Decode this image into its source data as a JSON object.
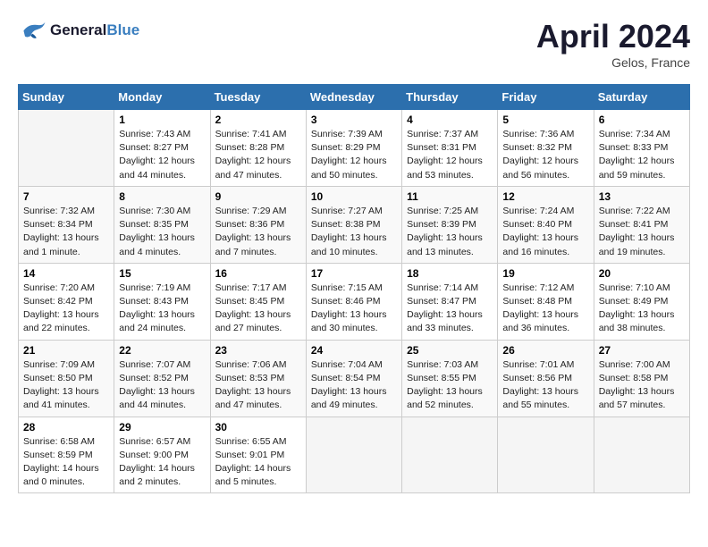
{
  "header": {
    "logo_line1": "General",
    "logo_line2": "Blue",
    "month": "April 2024",
    "location": "Gelos, France"
  },
  "columns": [
    "Sunday",
    "Monday",
    "Tuesday",
    "Wednesday",
    "Thursday",
    "Friday",
    "Saturday"
  ],
  "weeks": [
    [
      {
        "day": "",
        "info": ""
      },
      {
        "day": "1",
        "info": "Sunrise: 7:43 AM\nSunset: 8:27 PM\nDaylight: 12 hours\nand 44 minutes."
      },
      {
        "day": "2",
        "info": "Sunrise: 7:41 AM\nSunset: 8:28 PM\nDaylight: 12 hours\nand 47 minutes."
      },
      {
        "day": "3",
        "info": "Sunrise: 7:39 AM\nSunset: 8:29 PM\nDaylight: 12 hours\nand 50 minutes."
      },
      {
        "day": "4",
        "info": "Sunrise: 7:37 AM\nSunset: 8:31 PM\nDaylight: 12 hours\nand 53 minutes."
      },
      {
        "day": "5",
        "info": "Sunrise: 7:36 AM\nSunset: 8:32 PM\nDaylight: 12 hours\nand 56 minutes."
      },
      {
        "day": "6",
        "info": "Sunrise: 7:34 AM\nSunset: 8:33 PM\nDaylight: 12 hours\nand 59 minutes."
      }
    ],
    [
      {
        "day": "7",
        "info": "Sunrise: 7:32 AM\nSunset: 8:34 PM\nDaylight: 13 hours\nand 1 minute."
      },
      {
        "day": "8",
        "info": "Sunrise: 7:30 AM\nSunset: 8:35 PM\nDaylight: 13 hours\nand 4 minutes."
      },
      {
        "day": "9",
        "info": "Sunrise: 7:29 AM\nSunset: 8:36 PM\nDaylight: 13 hours\nand 7 minutes."
      },
      {
        "day": "10",
        "info": "Sunrise: 7:27 AM\nSunset: 8:38 PM\nDaylight: 13 hours\nand 10 minutes."
      },
      {
        "day": "11",
        "info": "Sunrise: 7:25 AM\nSunset: 8:39 PM\nDaylight: 13 hours\nand 13 minutes."
      },
      {
        "day": "12",
        "info": "Sunrise: 7:24 AM\nSunset: 8:40 PM\nDaylight: 13 hours\nand 16 minutes."
      },
      {
        "day": "13",
        "info": "Sunrise: 7:22 AM\nSunset: 8:41 PM\nDaylight: 13 hours\nand 19 minutes."
      }
    ],
    [
      {
        "day": "14",
        "info": "Sunrise: 7:20 AM\nSunset: 8:42 PM\nDaylight: 13 hours\nand 22 minutes."
      },
      {
        "day": "15",
        "info": "Sunrise: 7:19 AM\nSunset: 8:43 PM\nDaylight: 13 hours\nand 24 minutes."
      },
      {
        "day": "16",
        "info": "Sunrise: 7:17 AM\nSunset: 8:45 PM\nDaylight: 13 hours\nand 27 minutes."
      },
      {
        "day": "17",
        "info": "Sunrise: 7:15 AM\nSunset: 8:46 PM\nDaylight: 13 hours\nand 30 minutes."
      },
      {
        "day": "18",
        "info": "Sunrise: 7:14 AM\nSunset: 8:47 PM\nDaylight: 13 hours\nand 33 minutes."
      },
      {
        "day": "19",
        "info": "Sunrise: 7:12 AM\nSunset: 8:48 PM\nDaylight: 13 hours\nand 36 minutes."
      },
      {
        "day": "20",
        "info": "Sunrise: 7:10 AM\nSunset: 8:49 PM\nDaylight: 13 hours\nand 38 minutes."
      }
    ],
    [
      {
        "day": "21",
        "info": "Sunrise: 7:09 AM\nSunset: 8:50 PM\nDaylight: 13 hours\nand 41 minutes."
      },
      {
        "day": "22",
        "info": "Sunrise: 7:07 AM\nSunset: 8:52 PM\nDaylight: 13 hours\nand 44 minutes."
      },
      {
        "day": "23",
        "info": "Sunrise: 7:06 AM\nSunset: 8:53 PM\nDaylight: 13 hours\nand 47 minutes."
      },
      {
        "day": "24",
        "info": "Sunrise: 7:04 AM\nSunset: 8:54 PM\nDaylight: 13 hours\nand 49 minutes."
      },
      {
        "day": "25",
        "info": "Sunrise: 7:03 AM\nSunset: 8:55 PM\nDaylight: 13 hours\nand 52 minutes."
      },
      {
        "day": "26",
        "info": "Sunrise: 7:01 AM\nSunset: 8:56 PM\nDaylight: 13 hours\nand 55 minutes."
      },
      {
        "day": "27",
        "info": "Sunrise: 7:00 AM\nSunset: 8:58 PM\nDaylight: 13 hours\nand 57 minutes."
      }
    ],
    [
      {
        "day": "28",
        "info": "Sunrise: 6:58 AM\nSunset: 8:59 PM\nDaylight: 14 hours\nand 0 minutes."
      },
      {
        "day": "29",
        "info": "Sunrise: 6:57 AM\nSunset: 9:00 PM\nDaylight: 14 hours\nand 2 minutes."
      },
      {
        "day": "30",
        "info": "Sunrise: 6:55 AM\nSunset: 9:01 PM\nDaylight: 14 hours\nand 5 minutes."
      },
      {
        "day": "",
        "info": ""
      },
      {
        "day": "",
        "info": ""
      },
      {
        "day": "",
        "info": ""
      },
      {
        "day": "",
        "info": ""
      }
    ]
  ]
}
